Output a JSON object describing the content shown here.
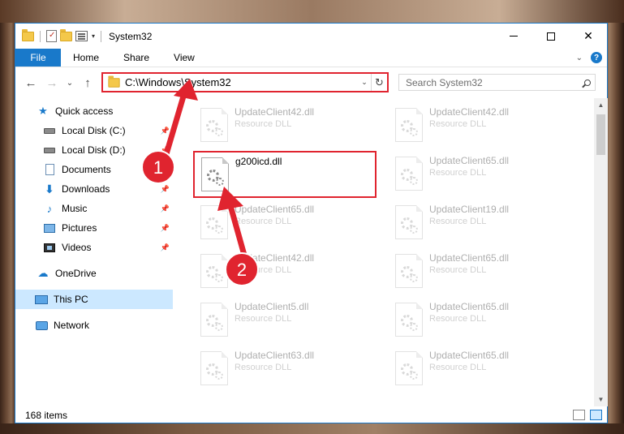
{
  "window": {
    "title": "System32",
    "controls": {
      "minimize": "minimize",
      "maximize": "maximize",
      "close": "✕"
    }
  },
  "ribbon": {
    "file_tab": "File",
    "tabs": [
      "Home",
      "Share",
      "View"
    ],
    "help": "?"
  },
  "nav": {
    "back": "←",
    "forward": "→",
    "recent": "⌄",
    "up": "↑",
    "address": "C:\\Windows\\System32",
    "address_dropdown": "⌄",
    "refresh": "↻",
    "search_placeholder": "Search System32"
  },
  "sidebar": {
    "items": [
      {
        "label": "Quick access",
        "icon": "star-icon"
      },
      {
        "label": "Local Disk (C:)",
        "icon": "drive-icon",
        "pinned": true
      },
      {
        "label": "Local Disk (D:)",
        "icon": "drive-icon",
        "pinned": true
      },
      {
        "label": "Documents",
        "icon": "documents-icon",
        "pinned": true
      },
      {
        "label": "Downloads",
        "icon": "downloads-icon",
        "pinned": true
      },
      {
        "label": "Music",
        "icon": "music-icon",
        "pinned": true
      },
      {
        "label": "Pictures",
        "icon": "pictures-icon",
        "pinned": true
      },
      {
        "label": "Videos",
        "icon": "videos-icon",
        "pinned": true
      },
      {
        "label": "OneDrive",
        "icon": "onedrive-icon"
      },
      {
        "label": "This PC",
        "icon": "this-pc-icon",
        "selected": true
      },
      {
        "label": "Network",
        "icon": "network-icon"
      }
    ]
  },
  "files": {
    "col1": [
      {
        "name": "UpdateClient42.dll",
        "type": "Resource DLL"
      },
      {
        "name": "g200icd.dll",
        "type": "",
        "highlighted": true
      },
      {
        "name": "UpdateClient65.dll",
        "type": "Resource DLL"
      },
      {
        "name": "UpdateClient42.dll",
        "type": "Resource DLL"
      },
      {
        "name": "UpdateClient5.dll",
        "type": "Resource DLL"
      },
      {
        "name": "UpdateClient63.dll",
        "type": "Resource DLL"
      }
    ],
    "col2": [
      {
        "name": "UpdateClient42.dll",
        "type": "Resource DLL"
      },
      {
        "name": "UpdateClient65.dll",
        "type": "Resource DLL"
      },
      {
        "name": "UpdateClient19.dll",
        "type": "Resource DLL"
      },
      {
        "name": "UpdateClient65.dll",
        "type": "Resource DLL"
      },
      {
        "name": "UpdateClient65.dll",
        "type": "Resource DLL"
      },
      {
        "name": "UpdateClient65.dll",
        "type": "Resource DLL"
      }
    ]
  },
  "status": {
    "item_count": "168 items"
  },
  "annotations": {
    "step1": "1",
    "step2": "2",
    "color": "#e0242f"
  }
}
